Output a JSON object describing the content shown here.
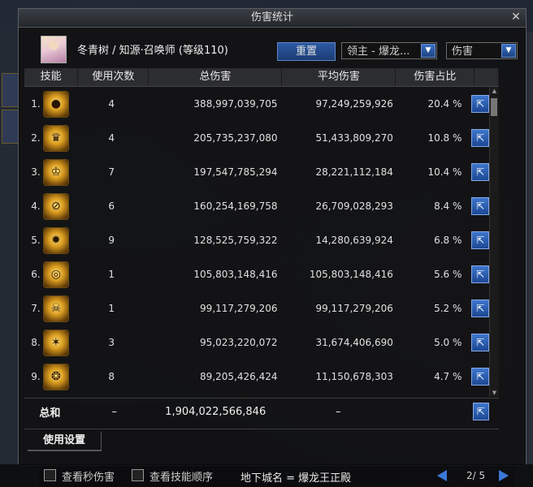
{
  "window": {
    "title": "伤害统计"
  },
  "player": {
    "text": "冬青树 / 知源·召唤师 (等级110)"
  },
  "controls": {
    "reset_label": "重置",
    "target_value": "领主 - 爆龙...",
    "metric_value": "伤害"
  },
  "table": {
    "headers": [
      "技能",
      "使用次数",
      "总伤害",
      "平均伤害",
      "伤害占比"
    ],
    "rows": [
      {
        "index": "1.",
        "icon": "dark-orbs-skill-icon",
        "uses": "4",
        "total": "388,997,039,705",
        "avg": "97,249,259,926",
        "pct": "20.4 %"
      },
      {
        "index": "2.",
        "icon": "golden-swarm-skill-icon",
        "uses": "4",
        "total": "205,735,237,080",
        "avg": "51,433,809,270",
        "pct": "10.8 %"
      },
      {
        "index": "3.",
        "icon": "crown-skill-icon",
        "uses": "7",
        "total": "197,547,785,294",
        "avg": "28,221,112,184",
        "pct": "10.4 %"
      },
      {
        "index": "4.",
        "icon": "slash-circle-skill-icon",
        "uses": "6",
        "total": "160,254,169,758",
        "avg": "26,709,028,293",
        "pct": "8.4 %"
      },
      {
        "index": "5.",
        "icon": "starburst-skill-icon",
        "uses": "9",
        "total": "128,525,759,322",
        "avg": "14,280,639,924",
        "pct": "6.8 %"
      },
      {
        "index": "6.",
        "icon": "vortex-skill-icon",
        "uses": "1",
        "total": "105,803,148,416",
        "avg": "105,803,148,416",
        "pct": "5.6 %"
      },
      {
        "index": "7.",
        "icon": "demon-face-skill-icon",
        "uses": "1",
        "total": "99,117,279,206",
        "avg": "99,117,279,206",
        "pct": "5.2 %"
      },
      {
        "index": "8.",
        "icon": "claw-skill-icon",
        "uses": "3",
        "total": "95,023,220,072",
        "avg": "31,674,406,690",
        "pct": "5.0 %"
      },
      {
        "index": "9.",
        "icon": "rune-circle-skill-icon",
        "uses": "8",
        "total": "89,205,426,424",
        "avg": "11,150,678,303",
        "pct": "4.7 %"
      }
    ]
  },
  "summary": {
    "label": "总和",
    "uses": "–",
    "total": "1,904,022,566,846",
    "avg": "–"
  },
  "tabs": {
    "usage_settings": "使用设置"
  },
  "footer": {
    "checkbox_1": "查看秒伤害",
    "checkbox_2": "查看技能顺序",
    "dungeon": "地下城名 = 爆龙王正殿",
    "page": "2/ 5"
  },
  "colors": {
    "accent": "#3b78d8",
    "gold": "#d79a1e",
    "panel": "#121214"
  }
}
